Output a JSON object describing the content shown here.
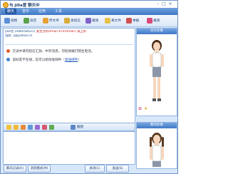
{
  "window": {
    "title": "与 ji0a曾 聊天中"
  },
  "tabs": [
    "聊天",
    "音乐",
    "应用",
    "工具"
  ],
  "toolbar": [
    {
      "label": "视频",
      "icon": "video-icon",
      "color": "#5d8fd6"
    },
    {
      "label": "语音",
      "icon": "voice-icon",
      "color": "#5aa24b"
    },
    {
      "label": "传文件",
      "icon": "file-icon",
      "color": "#e7a136"
    },
    {
      "label": "发短信",
      "icon": "sms-icon",
      "color": "#d8ab3e"
    },
    {
      "label": "邀请",
      "icon": "invite-icon",
      "color": "#7e62c4"
    },
    {
      "label": "来文件",
      "icon": "folder-icon",
      "color": "#e6c04b"
    },
    {
      "label": "举报",
      "icon": "report-icon",
      "color": "#d05050"
    },
    {
      "label": "邀请",
      "icon": "invite2-icon",
      "color": "#d74a7a"
    }
  ],
  "contact": {
    "line1": "ji0a曾 (448558521)",
    "line1b": "爱生活的Aman KTV(Aman) 保卫好",
    "line2": "电影: ji@yahoo.cn"
  },
  "messages": [
    {
      "text": "交谈中请勿轻信汇款、中奖消息，勿轻易拨打陌生电话。",
      "icon_color": "#e05a2c"
    },
    {
      "text": "该好友不在线，您可以给他发邮件（",
      "link": "发送邮件",
      "tail": "）",
      "icon_color": "#3b7fd0"
    }
  ],
  "side": {
    "top_title": "对方形象",
    "bottom_title": "我的形象"
  },
  "bottombar": {
    "image_label": "截图"
  },
  "footer": {
    "history": "聊天记录(H)",
    "mode": "消息模式(M)",
    "close": "关闭(C)",
    "send": "发送(S)"
  }
}
